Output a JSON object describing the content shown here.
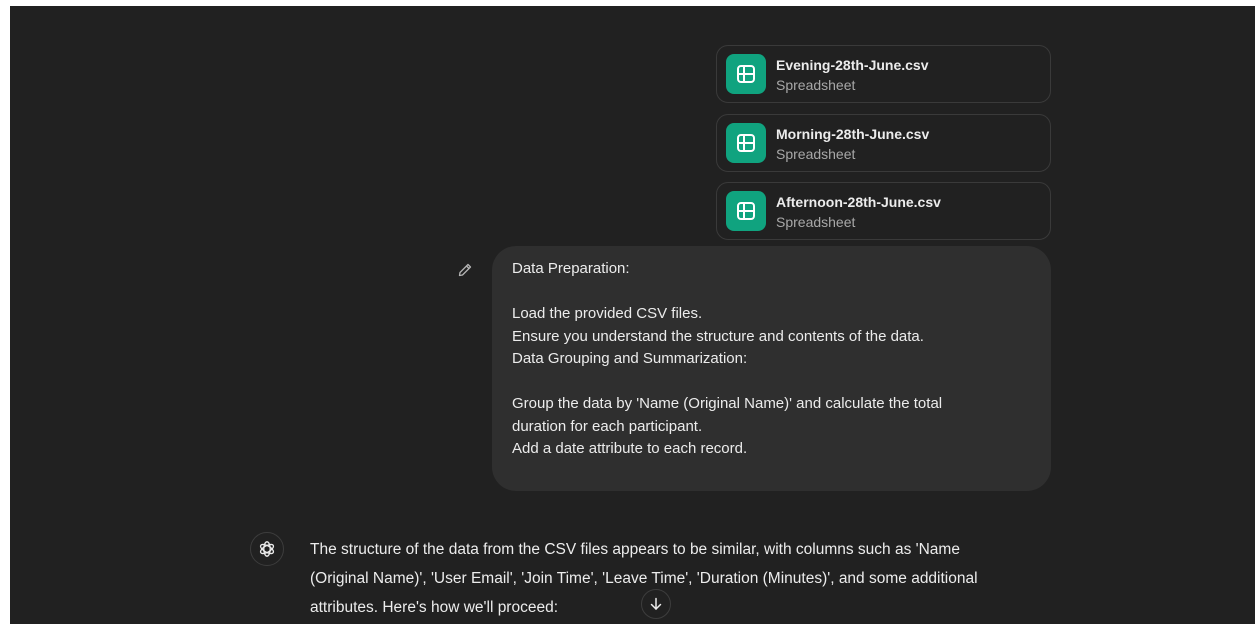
{
  "attachments": [
    {
      "name": "Evening-28th-June.csv",
      "type": "Spreadsheet",
      "icon": "spreadsheet-icon"
    },
    {
      "name": "Morning-28th-June.csv",
      "type": "Spreadsheet",
      "icon": "spreadsheet-icon"
    },
    {
      "name": "Afternoon-28th-June.csv",
      "type": "Spreadsheet",
      "icon": "spreadsheet-icon"
    }
  ],
  "user_message": {
    "lines": [
      "Data Preparation:",
      "",
      "Load the provided CSV files.",
      "Ensure you understand the structure and contents of the data.",
      "Data Grouping and Summarization:",
      "",
      "Group the data by 'Name (Original Name)' and calculate the total",
      "duration for each participant.",
      "Add a date attribute to each record."
    ],
    "edit_icon": "pencil-icon"
  },
  "assistant_message": {
    "avatar_icon": "openai-logo-icon",
    "lines": [
      "The structure of the data from the CSV files appears to be similar, with columns such as 'Name",
      "(Original Name)', 'User Email', 'Join Time', 'Leave Time', 'Duration (Minutes)', and some additional",
      "attributes. Here's how we'll proceed:"
    ]
  },
  "scroll_button": {
    "icon": "arrow-down-icon"
  },
  "colors": {
    "background": "#212121",
    "bubble": "#2f2f2f",
    "accent": "#10a37f",
    "text": "#ececec",
    "muted_text": "#a8a8a8"
  }
}
